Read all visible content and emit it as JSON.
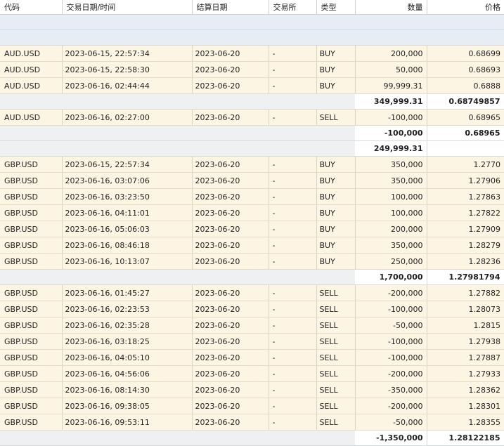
{
  "headers": [
    "代码",
    "交易日期/时间",
    "结算日期",
    "交易所",
    "类型",
    "数量",
    "价格"
  ],
  "rows": [
    {
      "kind": "blank"
    },
    {
      "kind": "blank"
    },
    {
      "kind": "row",
      "cells": [
        "AUD.USD",
        "2023-06-15, 22:57:34",
        "2023-06-20",
        "-",
        "BUY",
        "200,000",
        "0.68699"
      ]
    },
    {
      "kind": "row",
      "cells": [
        "AUD.USD",
        "2023-06-15, 22:58:30",
        "2023-06-20",
        "-",
        "BUY",
        "50,000",
        "0.68693"
      ]
    },
    {
      "kind": "row",
      "cells": [
        "AUD.USD",
        "2023-06-16, 02:44:44",
        "2023-06-20",
        "-",
        "BUY",
        "99,999.31",
        "0.6888"
      ]
    },
    {
      "kind": "sub",
      "qty": "349,999.31",
      "price": "0.68749857"
    },
    {
      "kind": "row",
      "cells": [
        "AUD.USD",
        "2023-06-16, 02:27:00",
        "2023-06-20",
        "-",
        "SELL",
        "-100,000",
        "0.68965"
      ]
    },
    {
      "kind": "sub",
      "qty": "-100,000",
      "price": "0.68965"
    },
    {
      "kind": "sub",
      "qty": "249,999.31",
      "price": ""
    },
    {
      "kind": "row",
      "cells": [
        "GBP.USD",
        "2023-06-15, 22:57:34",
        "2023-06-20",
        "-",
        "BUY",
        "350,000",
        "1.2770"
      ]
    },
    {
      "kind": "row",
      "cells": [
        "GBP.USD",
        "2023-06-16, 03:07:06",
        "2023-06-20",
        "-",
        "BUY",
        "350,000",
        "1.27906"
      ]
    },
    {
      "kind": "row",
      "cells": [
        "GBP.USD",
        "2023-06-16, 03:23:50",
        "2023-06-20",
        "-",
        "BUY",
        "100,000",
        "1.27863"
      ]
    },
    {
      "kind": "row",
      "cells": [
        "GBP.USD",
        "2023-06-16, 04:11:01",
        "2023-06-20",
        "-",
        "BUY",
        "100,000",
        "1.27822"
      ]
    },
    {
      "kind": "row",
      "cells": [
        "GBP.USD",
        "2023-06-16, 05:06:03",
        "2023-06-20",
        "-",
        "BUY",
        "200,000",
        "1.27909"
      ]
    },
    {
      "kind": "row",
      "cells": [
        "GBP.USD",
        "2023-06-16, 08:46:18",
        "2023-06-20",
        "-",
        "BUY",
        "350,000",
        "1.28279"
      ]
    },
    {
      "kind": "row",
      "cells": [
        "GBP.USD",
        "2023-06-16, 10:13:07",
        "2023-06-20",
        "-",
        "BUY",
        "250,000",
        "1.28236"
      ]
    },
    {
      "kind": "sub",
      "qty": "1,700,000",
      "price": "1.27981794"
    },
    {
      "kind": "row",
      "cells": [
        "GBP.USD",
        "2023-06-16, 01:45:27",
        "2023-06-20",
        "-",
        "SELL",
        "-200,000",
        "1.27882"
      ]
    },
    {
      "kind": "row",
      "cells": [
        "GBP.USD",
        "2023-06-16, 02:23:53",
        "2023-06-20",
        "-",
        "SELL",
        "-100,000",
        "1.28073"
      ]
    },
    {
      "kind": "row",
      "cells": [
        "GBP.USD",
        "2023-06-16, 02:35:28",
        "2023-06-20",
        "-",
        "SELL",
        "-50,000",
        "1.2815"
      ]
    },
    {
      "kind": "row",
      "cells": [
        "GBP.USD",
        "2023-06-16, 03:18:25",
        "2023-06-20",
        "-",
        "SELL",
        "-100,000",
        "1.27938"
      ]
    },
    {
      "kind": "row",
      "cells": [
        "GBP.USD",
        "2023-06-16, 04:05:10",
        "2023-06-20",
        "-",
        "SELL",
        "-100,000",
        "1.27887"
      ]
    },
    {
      "kind": "row",
      "cells": [
        "GBP.USD",
        "2023-06-16, 04:56:06",
        "2023-06-20",
        "-",
        "SELL",
        "-200,000",
        "1.27933"
      ]
    },
    {
      "kind": "row",
      "cells": [
        "GBP.USD",
        "2023-06-16, 08:14:30",
        "2023-06-20",
        "-",
        "SELL",
        "-350,000",
        "1.28362"
      ]
    },
    {
      "kind": "row",
      "cells": [
        "GBP.USD",
        "2023-06-16, 09:38:05",
        "2023-06-20",
        "-",
        "SELL",
        "-200,000",
        "1.28301"
      ]
    },
    {
      "kind": "row",
      "cells": [
        "GBP.USD",
        "2023-06-16, 09:53:11",
        "2023-06-20",
        "-",
        "SELL",
        "-50,000",
        "1.28355"
      ]
    },
    {
      "kind": "sub",
      "qty": "-1,350,000",
      "price": "1.28122185"
    }
  ]
}
